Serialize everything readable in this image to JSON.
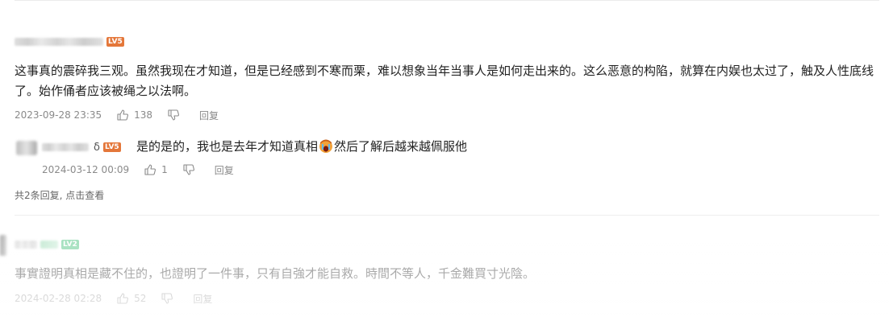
{
  "comments": [
    {
      "level_badge": "LV5",
      "level_badge_color": "#e4773a",
      "text": "这事真的震碎我三观。虽然我现在才知道，但是已经感到不寒而栗，难以想象当年当事人是如何走出来的。这么恶意的构陷，就算在内娱也太过了，触及人性底线了。始作俑者应该被绳之以法啊。",
      "date": "2023-09-28 23:35",
      "like_count": "138",
      "reply_label": "回复",
      "replies": [
        {
          "username_suffix": "δ",
          "level_badge": "LV5",
          "level_badge_color": "#e4773a",
          "text_before": "是的是的，我也是去年才知道真相",
          "emoji": "crying-face-emoji",
          "text_after": "然后了解后越来越佩服他",
          "date": "2024-03-12 00:09",
          "like_count": "1",
          "reply_label": "回复"
        }
      ],
      "see_replies_label": "共2条回复, 点击查看"
    },
    {
      "level_badge": "LV2",
      "level_badge_color": "#5cc98a",
      "text": "事實證明真相是藏不住的，也證明了一件事，只有自強才能自救。時間不等人，千金難買寸光陰。",
      "date": "2024-02-28 02:28",
      "like_count": "52",
      "reply_label": "回复"
    }
  ],
  "colors": {
    "text": "#222222",
    "meta": "#8a8a8a",
    "divider": "#ececec"
  }
}
